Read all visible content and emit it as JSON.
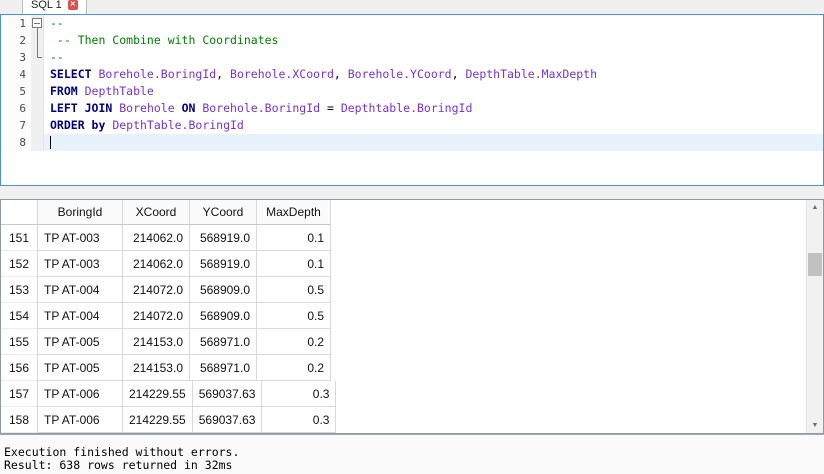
{
  "tab_bar": {
    "tabs": [
      {
        "label": "SQL 1",
        "close_icon": "✕"
      }
    ]
  },
  "colors": {
    "comment": "#007f00",
    "keyword": "#00007f",
    "identifier": "#7733cc",
    "plain": "#000000",
    "current_line_bg": "#e8f2fc",
    "focus_border": "#4d90d9"
  },
  "editor": {
    "lines": [
      {
        "num": "1",
        "fold": "open",
        "segments": [
          {
            "text": "--",
            "type": "comment"
          }
        ]
      },
      {
        "num": "2",
        "fold": "line",
        "segments": [
          {
            "text": " -- Then Combine with Coordinates",
            "type": "comment"
          }
        ]
      },
      {
        "num": "3",
        "fold": "end",
        "segments": [
          {
            "text": "--",
            "type": "comment"
          }
        ]
      },
      {
        "num": "4",
        "segments": [
          {
            "text": "SELECT ",
            "type": "keyword"
          },
          {
            "text": "Borehole.BoringId",
            "type": "identifier"
          },
          {
            "text": ", ",
            "type": "plain"
          },
          {
            "text": "Borehole.XCoord",
            "type": "identifier"
          },
          {
            "text": ", ",
            "type": "plain"
          },
          {
            "text": "Borehole.YCoord",
            "type": "identifier"
          },
          {
            "text": ", ",
            "type": "plain"
          },
          {
            "text": "DepthTable.MaxDepth",
            "type": "identifier"
          }
        ]
      },
      {
        "num": "5",
        "segments": [
          {
            "text": "FROM ",
            "type": "keyword"
          },
          {
            "text": "DepthTable",
            "type": "identifier"
          }
        ]
      },
      {
        "num": "6",
        "segments": [
          {
            "text": "LEFT JOIN ",
            "type": "keyword"
          },
          {
            "text": "Borehole ",
            "type": "identifier"
          },
          {
            "text": "ON ",
            "type": "keyword"
          },
          {
            "text": "Borehole.BoringId",
            "type": "identifier"
          },
          {
            "text": " = ",
            "type": "plain"
          },
          {
            "text": "Depthtable.BoringId",
            "type": "identifier"
          }
        ]
      },
      {
        "num": "7",
        "segments": [
          {
            "text": "ORDER by ",
            "type": "keyword"
          },
          {
            "text": "DepthTable.BoringId",
            "type": "identifier"
          }
        ]
      },
      {
        "num": "8",
        "current": true,
        "segments": []
      }
    ]
  },
  "results": {
    "columns": [
      "BoringId",
      "XCoord",
      "YCoord",
      "MaxDepth"
    ],
    "rows": [
      {
        "num": "151",
        "cells": [
          "TP AT-003",
          "214062.0",
          "568919.0",
          "0.1"
        ]
      },
      {
        "num": "152",
        "cells": [
          "TP AT-003",
          "214062.0",
          "568919.0",
          "0.1"
        ]
      },
      {
        "num": "153",
        "cells": [
          "TP AT-004",
          "214072.0",
          "568909.0",
          "0.5"
        ]
      },
      {
        "num": "154",
        "cells": [
          "TP AT-004",
          "214072.0",
          "568909.0",
          "0.5"
        ]
      },
      {
        "num": "155",
        "cells": [
          "TP AT-005",
          "214153.0",
          "568971.0",
          "0.2"
        ]
      },
      {
        "num": "156",
        "cells": [
          "TP AT-005",
          "214153.0",
          "568971.0",
          "0.2"
        ]
      },
      {
        "num": "157",
        "cells": [
          "TP AT-006",
          "214229.55",
          "569037.63",
          "0.3"
        ]
      },
      {
        "num": "158",
        "cells": [
          "TP AT-006",
          "214229.55",
          "569037.63",
          "0.3"
        ]
      }
    ]
  },
  "scrollbar": {
    "up_icon": "▲",
    "down_icon": "▼"
  },
  "status": {
    "line1": "Execution finished without errors.",
    "line2": "Result: 638 rows returned in 32ms"
  }
}
